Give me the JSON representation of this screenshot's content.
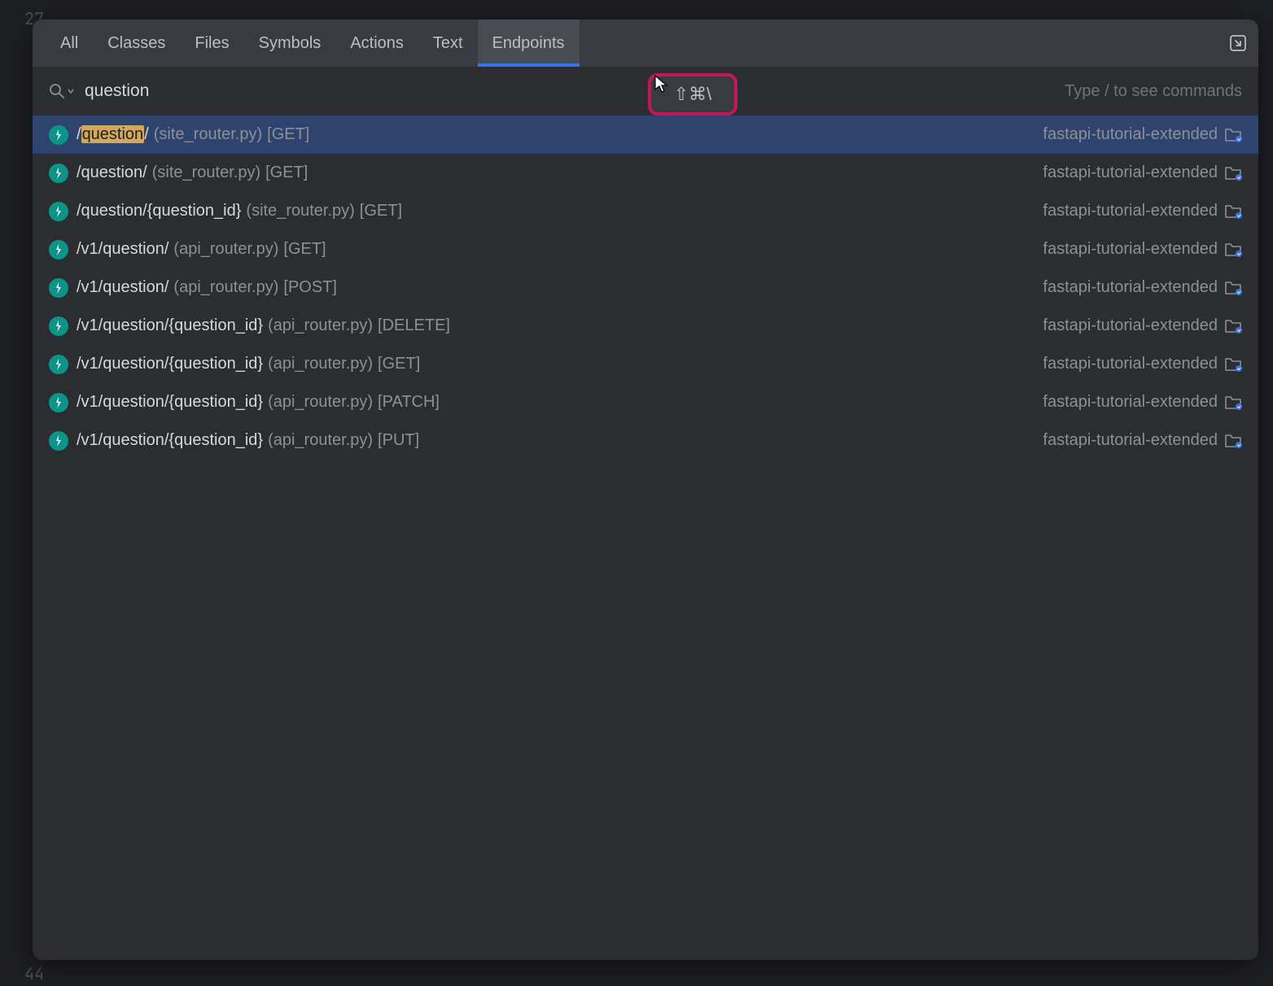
{
  "editor": {
    "line_top": "27",
    "line_bottom": "44"
  },
  "tabs": [
    {
      "label": "All",
      "active": false
    },
    {
      "label": "Classes",
      "active": false
    },
    {
      "label": "Files",
      "active": false
    },
    {
      "label": "Symbols",
      "active": false
    },
    {
      "label": "Actions",
      "active": false
    },
    {
      "label": "Text",
      "active": false
    },
    {
      "label": "Endpoints",
      "active": true
    }
  ],
  "search": {
    "value": "question",
    "hint": "Type / to see commands"
  },
  "shortcut": {
    "label": "⇧⌘\\"
  },
  "results": [
    {
      "pre": "/",
      "match": "question",
      "post": "/",
      "file": "(site_router.py)",
      "method": "[GET]",
      "project": "fastapi-tutorial-extended",
      "selected": true,
      "highlight": true
    },
    {
      "pre": "/question/",
      "match": "",
      "post": "",
      "file": "(site_router.py)",
      "method": "[GET]",
      "project": "fastapi-tutorial-extended",
      "selected": false,
      "highlight": false
    },
    {
      "pre": "/question/{question_id}",
      "match": "",
      "post": "",
      "file": "(site_router.py)",
      "method": "[GET]",
      "project": "fastapi-tutorial-extended",
      "selected": false,
      "highlight": false
    },
    {
      "pre": "/v1/question/",
      "match": "",
      "post": "",
      "file": "(api_router.py)",
      "method": "[GET]",
      "project": "fastapi-tutorial-extended",
      "selected": false,
      "highlight": false
    },
    {
      "pre": "/v1/question/",
      "match": "",
      "post": "",
      "file": "(api_router.py)",
      "method": "[POST]",
      "project": "fastapi-tutorial-extended",
      "selected": false,
      "highlight": false
    },
    {
      "pre": "/v1/question/{question_id}",
      "match": "",
      "post": "",
      "file": "(api_router.py)",
      "method": "[DELETE]",
      "project": "fastapi-tutorial-extended",
      "selected": false,
      "highlight": false
    },
    {
      "pre": "/v1/question/{question_id}",
      "match": "",
      "post": "",
      "file": "(api_router.py)",
      "method": "[GET]",
      "project": "fastapi-tutorial-extended",
      "selected": false,
      "highlight": false
    },
    {
      "pre": "/v1/question/{question_id}",
      "match": "",
      "post": "",
      "file": "(api_router.py)",
      "method": "[PATCH]",
      "project": "fastapi-tutorial-extended",
      "selected": false,
      "highlight": false
    },
    {
      "pre": "/v1/question/{question_id}",
      "match": "",
      "post": "",
      "file": "(api_router.py)",
      "method": "[PUT]",
      "project": "fastapi-tutorial-extended",
      "selected": false,
      "highlight": false
    }
  ]
}
